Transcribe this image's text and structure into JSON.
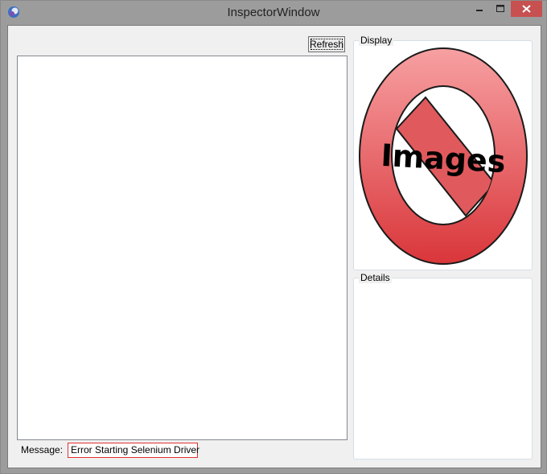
{
  "window": {
    "title": "InspectorWindow"
  },
  "toolbar": {
    "refresh_label": "Refresh"
  },
  "message": {
    "label": "Message:",
    "value": "Error Starting Selenium Driver"
  },
  "display": {
    "label": "Display",
    "placeholder_text": "Images"
  },
  "details": {
    "label": "Details"
  },
  "colors": {
    "error_border": "#e03030",
    "noimage_fill": "#e8575a",
    "close_button": "#c75050"
  }
}
